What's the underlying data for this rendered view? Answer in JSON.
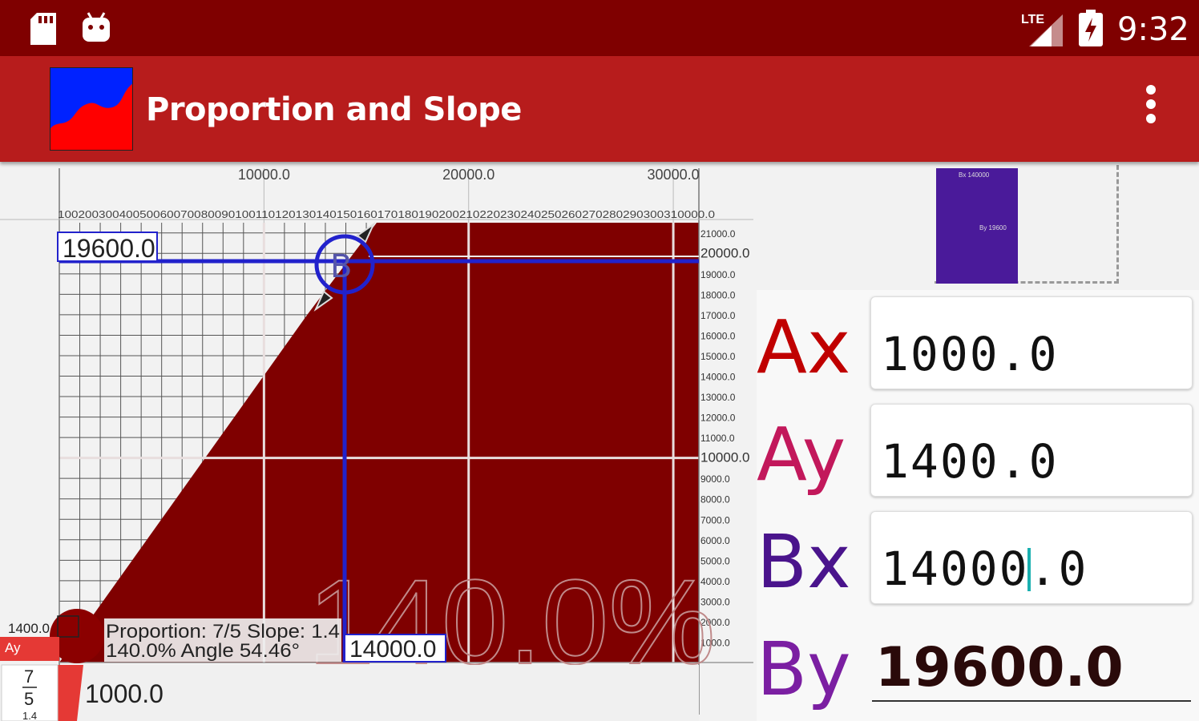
{
  "status_bar": {
    "time": "9:32",
    "network": "LTE"
  },
  "app_bar": {
    "title": "Proportion and Slope"
  },
  "chart": {
    "x_top_ticks": [
      "10000.0",
      "20000.0",
      "30000.0"
    ],
    "x_fine_ticks": "10020030040050060070080090100110120130140150160170180190200210220230240250260270280290300310000.0",
    "y_right_ticks": [
      "21000.0",
      "20000.0",
      "19000.0",
      "18000.0",
      "17000.0",
      "16000.0",
      "15000.0",
      "14000.0",
      "13000.0",
      "12000.0",
      "11000.0",
      "10000.0",
      "9000.0",
      "8000.0",
      "7000.0",
      "6000.0",
      "5000.0",
      "4000.0",
      "3000.0",
      "2000.0",
      "1000.0"
    ],
    "by_label": "19600.0",
    "bx_label": "14000.0",
    "ay_value": "1400.0",
    "ay_tag": "Ay",
    "ax_value": "1000.0",
    "point_b_letter": "B",
    "watermark": "140.0%",
    "info_line1": "Proportion: 7/5 Slope: 1.4",
    "info_line2": "140.0% Angle 54.46°",
    "fraction": {
      "num": "7",
      "den": "5",
      "extra": "1.4"
    },
    "colors": {
      "fill": "#7f0000",
      "guide": "#2222cc",
      "grid": "#555555"
    }
  },
  "thumbnail": {
    "text1": "Bx 140000",
    "text2": "By 19600"
  },
  "fields": {
    "ax": {
      "label": "Ax",
      "value": "1000.0",
      "color": "#c00000"
    },
    "ay": {
      "label": "Ay",
      "value": "1400.0",
      "color": "#c2185b"
    },
    "bx": {
      "label": "Bx",
      "value_before_cursor": "14000",
      "value_after_cursor": ".0",
      "color": "#4a148c"
    },
    "by": {
      "label": "By",
      "value": "19600.0",
      "color": "#7b1fa2"
    }
  }
}
